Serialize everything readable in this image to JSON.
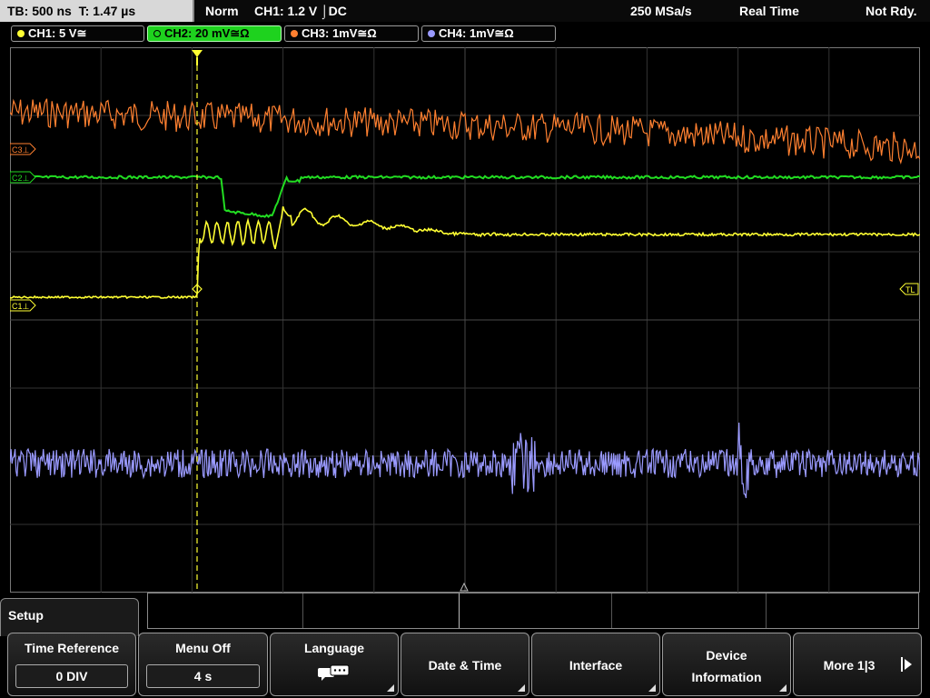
{
  "status": {
    "timebase": "TB: 500 ns",
    "trigger_time": "T: 1.47 µs",
    "mode": "Norm",
    "trigger": "CH1: 1.2 V ⌡DC",
    "sample_rate": "250 MSa/s",
    "acquisition": "Real Time",
    "state": "Not Rdy."
  },
  "channels": [
    {
      "label": "CH1: 5 V≅",
      "color": "#ffff33",
      "active": false
    },
    {
      "label": "CH2: 20 mV≅Ω",
      "color": "#22dd22",
      "active": true
    },
    {
      "label": "CH3: 1mV≅Ω",
      "color": "#ff8030",
      "active": false
    },
    {
      "label": "CH4: 1mV≅Ω",
      "color": "#9a9aff",
      "active": false
    }
  ],
  "markers": {
    "c3": "C3⊥",
    "c2": "C2⊥",
    "c1": "C1⊥",
    "trigger_level": "TL"
  },
  "menu": {
    "title": "Setup",
    "softkeys": [
      {
        "label": "Time Reference",
        "value": "0 DIV"
      },
      {
        "label": "Menu Off",
        "value": "4 s"
      },
      {
        "label": "Language",
        "icon": "speech-bubble-icon"
      },
      {
        "label": "Date & Time"
      },
      {
        "label": "Interface"
      },
      {
        "label_line1": "Device",
        "label_line2": "Information"
      },
      {
        "label": "More 1|3"
      }
    ]
  },
  "colors": {
    "ch1": "#ffff33",
    "ch2": "#22dd22",
    "ch3": "#ff8030",
    "ch4": "#9a9aff",
    "grid": "#3a3a3a"
  }
}
